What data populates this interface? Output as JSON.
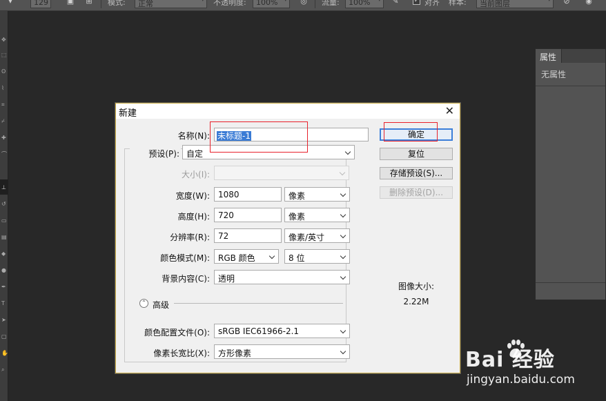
{
  "options_bar": {
    "brush_size": "129",
    "mode_label": "模式:",
    "mode_value": "正常",
    "opacity_label": "不透明度:",
    "opacity_value": "100%",
    "flow_label": "流量:",
    "flow_value": "100%",
    "align_label": "对齐",
    "sample_label": "样本:",
    "sample_value": "当前图层"
  },
  "properties_panel": {
    "tab_label": "属性",
    "empty_text": "无属性"
  },
  "dialog": {
    "title": "新建",
    "name_label": "名称(N):",
    "name_value": "未标题-1",
    "preset_label": "预设(P):",
    "preset_value": "自定",
    "size_label": "大小(I):",
    "size_value": "",
    "width_label": "宽度(W):",
    "width_value": "1080",
    "width_unit": "像素",
    "height_label": "高度(H):",
    "height_value": "720",
    "height_unit": "像素",
    "resolution_label": "分辨率(R):",
    "resolution_value": "72",
    "resolution_unit": "像素/英寸",
    "color_mode_label": "颜色模式(M):",
    "color_mode_value": "RGB 颜色",
    "bit_depth_value": "8 位",
    "background_label": "背景内容(C):",
    "background_value": "透明",
    "advanced_label": "高级",
    "color_profile_label": "颜色配置文件(O):",
    "color_profile_value": "sRGB IEC61966-2.1",
    "pixel_aspect_label": "像素长宽比(X):",
    "pixel_aspect_value": "方形像素",
    "ok_button": "确定",
    "reset_button": "复位",
    "save_preset_button": "存储预设(S)...",
    "delete_preset_button": "删除预设(D)...",
    "image_size_label": "图像大小:",
    "image_size_value": "2.22M"
  },
  "watermark": {
    "brand": "Bai  经验",
    "url": "jingyan.baidu.com"
  },
  "colors": {
    "workspace": "#282828",
    "dialog_bg": "#f0f0f0",
    "highlight_red": "#e8202a",
    "selection_blue": "#3a7bd5",
    "primary_border": "#3c7fd9"
  }
}
